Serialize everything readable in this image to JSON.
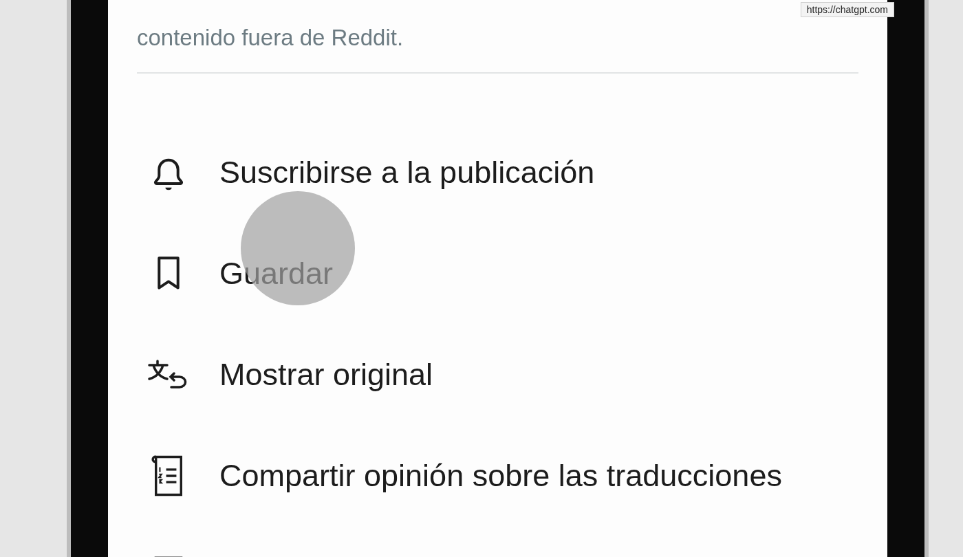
{
  "tooltip": {
    "url": "https://chatgpt.com"
  },
  "notice": "contenido fuera de Reddit.",
  "menu": [
    {
      "label": "Suscribirse a la publicación"
    },
    {
      "label": "Guardar"
    },
    {
      "label": "Mostrar original"
    },
    {
      "label": "Compartir opinión sobre las traducciones"
    }
  ]
}
